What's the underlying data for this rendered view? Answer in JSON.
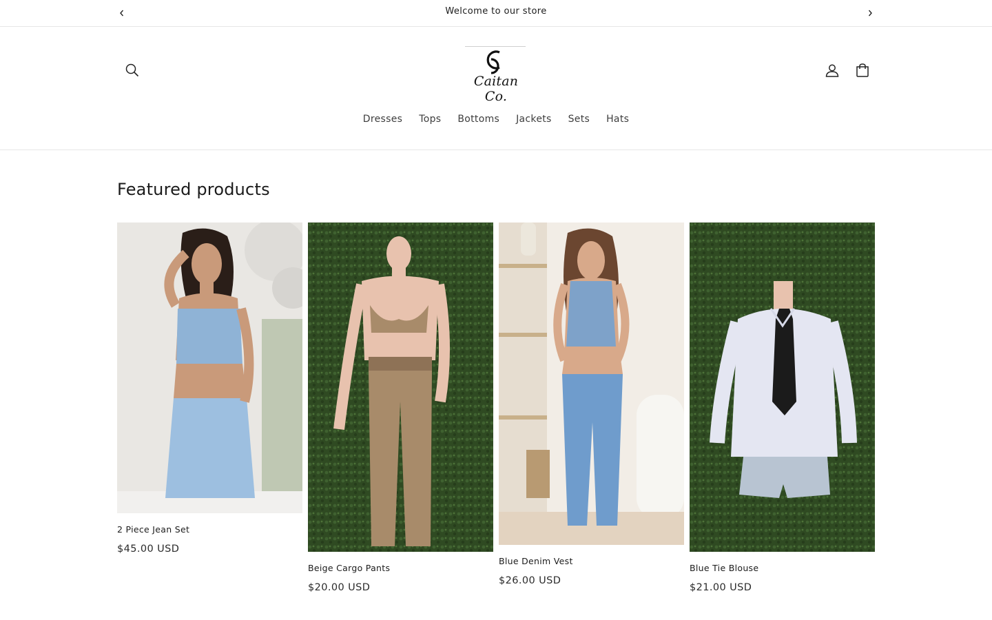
{
  "announcement": {
    "text": "Welcome to our store"
  },
  "brand": {
    "name": "Caitan Co."
  },
  "nav": {
    "items": [
      "Dresses",
      "Tops",
      "Bottoms",
      "Jackets",
      "Sets",
      "Hats"
    ]
  },
  "featured": {
    "title": "Featured products",
    "products": [
      {
        "title": "2 Piece Jean Set",
        "price": "$45.00 USD"
      },
      {
        "title": "Beige Cargo Pants",
        "price": "$20.00 USD"
      },
      {
        "title": "Blue Denim Vest",
        "price": "$26.00 USD"
      },
      {
        "title": "Blue Tie Blouse",
        "price": "$21.00 USD"
      }
    ]
  },
  "colors": {
    "text": "#121212",
    "border": "#e6e6e6",
    "denim": "#8fb3d6",
    "hedge": "#2f4a22",
    "beige": "#a88b6a"
  },
  "icons": [
    "chevron-left-icon",
    "chevron-right-icon",
    "search-icon",
    "account-icon",
    "cart-icon"
  ]
}
